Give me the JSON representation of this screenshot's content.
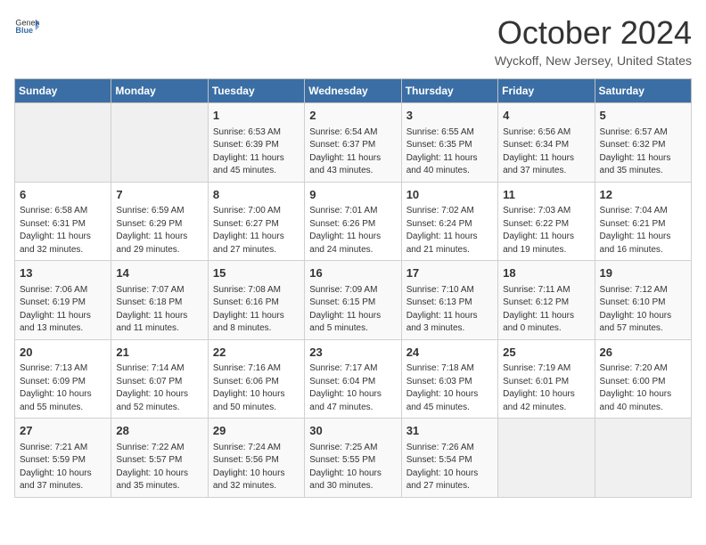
{
  "header": {
    "logo_general": "General",
    "logo_blue": "Blue",
    "month_title": "October 2024",
    "location": "Wyckoff, New Jersey, United States"
  },
  "days_of_week": [
    "Sunday",
    "Monday",
    "Tuesday",
    "Wednesday",
    "Thursday",
    "Friday",
    "Saturday"
  ],
  "weeks": [
    [
      {
        "day": "",
        "empty": true
      },
      {
        "day": "",
        "empty": true
      },
      {
        "day": "1",
        "sunrise": "6:53 AM",
        "sunset": "6:39 PM",
        "daylight": "11 hours and 45 minutes."
      },
      {
        "day": "2",
        "sunrise": "6:54 AM",
        "sunset": "6:37 PM",
        "daylight": "11 hours and 43 minutes."
      },
      {
        "day": "3",
        "sunrise": "6:55 AM",
        "sunset": "6:35 PM",
        "daylight": "11 hours and 40 minutes."
      },
      {
        "day": "4",
        "sunrise": "6:56 AM",
        "sunset": "6:34 PM",
        "daylight": "11 hours and 37 minutes."
      },
      {
        "day": "5",
        "sunrise": "6:57 AM",
        "sunset": "6:32 PM",
        "daylight": "11 hours and 35 minutes."
      }
    ],
    [
      {
        "day": "6",
        "sunrise": "6:58 AM",
        "sunset": "6:31 PM",
        "daylight": "11 hours and 32 minutes."
      },
      {
        "day": "7",
        "sunrise": "6:59 AM",
        "sunset": "6:29 PM",
        "daylight": "11 hours and 29 minutes."
      },
      {
        "day": "8",
        "sunrise": "7:00 AM",
        "sunset": "6:27 PM",
        "daylight": "11 hours and 27 minutes."
      },
      {
        "day": "9",
        "sunrise": "7:01 AM",
        "sunset": "6:26 PM",
        "daylight": "11 hours and 24 minutes."
      },
      {
        "day": "10",
        "sunrise": "7:02 AM",
        "sunset": "6:24 PM",
        "daylight": "11 hours and 21 minutes."
      },
      {
        "day": "11",
        "sunrise": "7:03 AM",
        "sunset": "6:22 PM",
        "daylight": "11 hours and 19 minutes."
      },
      {
        "day": "12",
        "sunrise": "7:04 AM",
        "sunset": "6:21 PM",
        "daylight": "11 hours and 16 minutes."
      }
    ],
    [
      {
        "day": "13",
        "sunrise": "7:06 AM",
        "sunset": "6:19 PM",
        "daylight": "11 hours and 13 minutes."
      },
      {
        "day": "14",
        "sunrise": "7:07 AM",
        "sunset": "6:18 PM",
        "daylight": "11 hours and 11 minutes."
      },
      {
        "day": "15",
        "sunrise": "7:08 AM",
        "sunset": "6:16 PM",
        "daylight": "11 hours and 8 minutes."
      },
      {
        "day": "16",
        "sunrise": "7:09 AM",
        "sunset": "6:15 PM",
        "daylight": "11 hours and 5 minutes."
      },
      {
        "day": "17",
        "sunrise": "7:10 AM",
        "sunset": "6:13 PM",
        "daylight": "11 hours and 3 minutes."
      },
      {
        "day": "18",
        "sunrise": "7:11 AM",
        "sunset": "6:12 PM",
        "daylight": "11 hours and 0 minutes."
      },
      {
        "day": "19",
        "sunrise": "7:12 AM",
        "sunset": "6:10 PM",
        "daylight": "10 hours and 57 minutes."
      }
    ],
    [
      {
        "day": "20",
        "sunrise": "7:13 AM",
        "sunset": "6:09 PM",
        "daylight": "10 hours and 55 minutes."
      },
      {
        "day": "21",
        "sunrise": "7:14 AM",
        "sunset": "6:07 PM",
        "daylight": "10 hours and 52 minutes."
      },
      {
        "day": "22",
        "sunrise": "7:16 AM",
        "sunset": "6:06 PM",
        "daylight": "10 hours and 50 minutes."
      },
      {
        "day": "23",
        "sunrise": "7:17 AM",
        "sunset": "6:04 PM",
        "daylight": "10 hours and 47 minutes."
      },
      {
        "day": "24",
        "sunrise": "7:18 AM",
        "sunset": "6:03 PM",
        "daylight": "10 hours and 45 minutes."
      },
      {
        "day": "25",
        "sunrise": "7:19 AM",
        "sunset": "6:01 PM",
        "daylight": "10 hours and 42 minutes."
      },
      {
        "day": "26",
        "sunrise": "7:20 AM",
        "sunset": "6:00 PM",
        "daylight": "10 hours and 40 minutes."
      }
    ],
    [
      {
        "day": "27",
        "sunrise": "7:21 AM",
        "sunset": "5:59 PM",
        "daylight": "10 hours and 37 minutes."
      },
      {
        "day": "28",
        "sunrise": "7:22 AM",
        "sunset": "5:57 PM",
        "daylight": "10 hours and 35 minutes."
      },
      {
        "day": "29",
        "sunrise": "7:24 AM",
        "sunset": "5:56 PM",
        "daylight": "10 hours and 32 minutes."
      },
      {
        "day": "30",
        "sunrise": "7:25 AM",
        "sunset": "5:55 PM",
        "daylight": "10 hours and 30 minutes."
      },
      {
        "day": "31",
        "sunrise": "7:26 AM",
        "sunset": "5:54 PM",
        "daylight": "10 hours and 27 minutes."
      },
      {
        "day": "",
        "empty": true
      },
      {
        "day": "",
        "empty": true
      }
    ]
  ]
}
